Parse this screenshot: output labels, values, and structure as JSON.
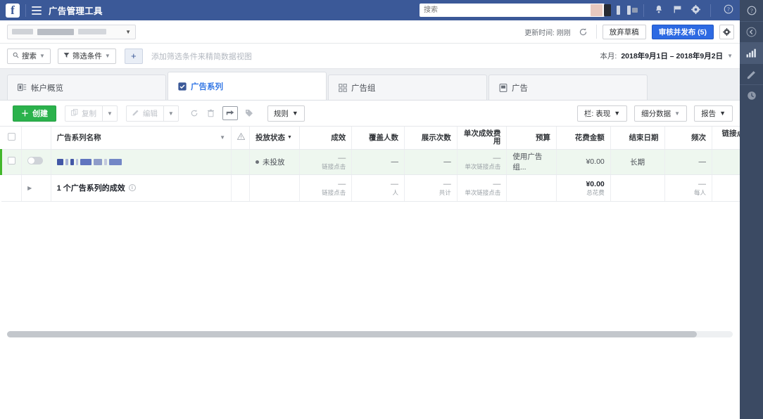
{
  "topbar": {
    "logo_letter": "f",
    "menu_icon": "hamburger-icon",
    "app_title": "广告管理工具",
    "search_placeholder": "搜索",
    "search_value": "",
    "search_icon": "search-icon",
    "bell_icon": "notifications-bell-icon",
    "flag_icon": "pages-flag-icon",
    "gear_icon": "settings-gear-icon",
    "help_icon": "help-question-icon",
    "brand_color": "#3b5998"
  },
  "account_bar": {
    "account_name_blurred": "",
    "caret_icon": "chevron-down-icon",
    "update_label": "更新时间: 刚刚",
    "refresh_icon": "refresh-icon",
    "discard_label": "放弃草稿",
    "publish_label": "审核并发布 (5)",
    "publish_color": "#2d6ae3",
    "settings_icon": "gear-icon"
  },
  "filter_bar": {
    "search_label": "搜索",
    "search_icon": "search-icon",
    "filter_label": "筛选条件",
    "filter_icon": "funnel-icon",
    "add_label": "+",
    "hint": "添加筛选条件来精简数据视图",
    "date_prefix": "本月:",
    "date_range": "2018年9月1日 – 2018年9月2日",
    "date_caret": "chevron-down-icon"
  },
  "tabs": [
    {
      "label": "帐户概览",
      "icon": "account-overview-icon",
      "active": false
    },
    {
      "label": "广告系列",
      "icon": "campaign-checkbox-icon",
      "active": true
    },
    {
      "label": "广告组",
      "icon": "adset-grid-icon",
      "active": false
    },
    {
      "label": "广告",
      "icon": "ad-rectangle-icon",
      "active": false
    }
  ],
  "toolbar": {
    "create_label": "创建",
    "create_icon": "plus-icon",
    "create_color": "#2bb24c",
    "duplicate_label": "复制",
    "duplicate_icon": "duplicate-icon",
    "edit_label": "编辑",
    "edit_icon": "pencil-icon",
    "refresh_icon": "refresh-icon",
    "delete_icon": "trash-icon",
    "export_icon": "export-icon",
    "tag_icon": "tag-icon",
    "rules_label": "规则",
    "columns_label": "栏: 表现",
    "breakdown_label": "细分数据",
    "reports_label": "报告",
    "caret_icon": "chevron-down-icon"
  },
  "table": {
    "select_all_checkbox": "",
    "columns": [
      {
        "key": "name",
        "label": "广告系列名称",
        "align": "left",
        "sorted": false
      },
      {
        "key": "warning",
        "label": "",
        "icon": "warning-triangle-icon",
        "align": "center",
        "sorted": false
      },
      {
        "key": "status",
        "label": "投放状态",
        "align": "left",
        "sorted": true
      },
      {
        "key": "results",
        "label": "成效",
        "align": "right",
        "sorted": false
      },
      {
        "key": "reach",
        "label": "覆盖人数",
        "align": "right",
        "sorted": false
      },
      {
        "key": "impressions",
        "label": "展示次数",
        "align": "right",
        "sorted": false
      },
      {
        "key": "cost_per_result",
        "label": "单次成效费用",
        "align": "right",
        "sorted": false
      },
      {
        "key": "budget",
        "label": "预算",
        "align": "right",
        "sorted": false
      },
      {
        "key": "amount_spent",
        "label": "花费金额",
        "align": "right",
        "sorted": false
      },
      {
        "key": "end_date",
        "label": "结束日期",
        "align": "right",
        "sorted": false
      },
      {
        "key": "frequency",
        "label": "频次",
        "align": "right",
        "sorted": false
      },
      {
        "key": "link_clicks",
        "label": "链接点击 独立用",
        "align": "right",
        "sorted": false
      }
    ],
    "rows": [
      {
        "name_blurred": "",
        "toggle_on": false,
        "status": "未投放",
        "results": "—",
        "results_sub": "链接点击",
        "reach": "—",
        "impressions": "—",
        "cost_per_result": "—",
        "cost_per_result_sub": "单次链接点击",
        "budget": "使用广告组...",
        "amount_spent": "¥0.00",
        "end_date": "长期",
        "frequency": "—"
      }
    ],
    "summary": {
      "label": "1 个广告系列的成效",
      "info_icon": "info-icon",
      "expand_icon": "chevron-right-icon",
      "results": "—",
      "results_sub": "链接点击",
      "reach": "—",
      "reach_sub": "人",
      "impressions": "—",
      "impressions_sub": "共计",
      "cost_per_result": "—",
      "cost_per_result_sub": "单次链接点击",
      "budget": "",
      "amount_spent": "¥0.00",
      "amount_spent_sub": "总花费",
      "end_date": "",
      "frequency": "—",
      "frequency_sub": "每人"
    }
  },
  "right_rail": [
    {
      "icon": "help-question-icon",
      "active": false
    },
    {
      "icon": "chevron-left-circle-icon",
      "active": false
    },
    {
      "icon": "bar-chart-icon",
      "active": true
    },
    {
      "icon": "pencil-icon",
      "active": false
    },
    {
      "icon": "clock-history-icon",
      "active": false
    }
  ]
}
